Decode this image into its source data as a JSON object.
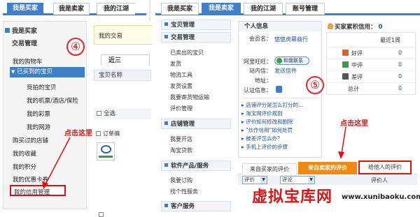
{
  "left_panel": {
    "tabs": [
      "我是买家",
      "我是卖家",
      "我的江湖"
    ],
    "buyer_header": "我是买家",
    "nav": {
      "trade_mgmt": "交易管理",
      "cart": "我的购物车",
      "bought": "已买到的宝贝",
      "bid": "竞拍的宝贝",
      "tickets": "我的机票/酒店/保险",
      "lottery": "我的彩票",
      "game": "我的网游",
      "shops": "购买过的店铺",
      "favorites": "我的收藏",
      "points": "我的积分",
      "coupons": "我的优惠卡券",
      "credit": "我的信用管理"
    },
    "frag_trade": "我的交易",
    "frag_tab": "近三",
    "frag_col": "宝贝名称",
    "select_all": "全选",
    "order_no": "订单编",
    "step": "④",
    "click_here": "点击这里"
  },
  "right_panel": {
    "tabs": [
      "我是买家",
      "我是卖家",
      "我的江湖",
      "账号管理"
    ],
    "nav": {
      "baby_mgmt": "宝贝管理",
      "trade_mgmt": "交易管理",
      "sold": "已卖出的宝贝",
      "shipping": "发货",
      "logistics": "物流工具",
      "ship_settings": "发货设置",
      "freight": "我要寄货物运输",
      "review_mgmt": "评价管理",
      "store_mgmt": "店铺管理",
      "open_store": "我要开店",
      "loan": "淘宝贷款",
      "software": "软件产品/服务",
      "order": "我要订购",
      "personal_svc": "找个性服务",
      "customer_svc": "客户服务"
    },
    "info": {
      "title": "个人信息",
      "member_label": "会员名：",
      "member_value": "悠悠虎幕商行",
      "wangwang_label": "阿里旺旺：",
      "wangwang_value": "和我联系",
      "station_label": "站内信：",
      "station_value": "发送信件",
      "address_label": "地址：",
      "cert_label": "认证信息："
    },
    "tips": [
      "店铺评分是怎么打分的...",
      "淘宝网评价规则",
      "评价如何修改和删除",
      "\"炒作信用\"如何处罚",
      "被差评怎么办？",
      "手机上评价的步骤"
    ],
    "step": "⑤",
    "click_here": "点击这里",
    "credit": {
      "title": "买家累积信用：",
      "title_value": "0",
      "col_recent": "最近1周",
      "rows": [
        {
          "label": "好评",
          "value": "0"
        },
        {
          "label": "中评",
          "value": "0"
        },
        {
          "label": "差评",
          "value": "0"
        },
        {
          "label": "总计",
          "value": "0"
        }
      ]
    },
    "review_tabs": [
      "来自买家的评价",
      "来自卖家的评价",
      "给他人的评价"
    ],
    "filter1": "评价",
    "filter2": "评论",
    "col_reviewer": "评价人"
  },
  "watermark": "虚拟宝库网",
  "watermark_url": "www.xunibaoku.com",
  "colors": {
    "accent": "#3e7fc8",
    "highlight": "#f08a12",
    "annotation_red": "#e01010"
  }
}
